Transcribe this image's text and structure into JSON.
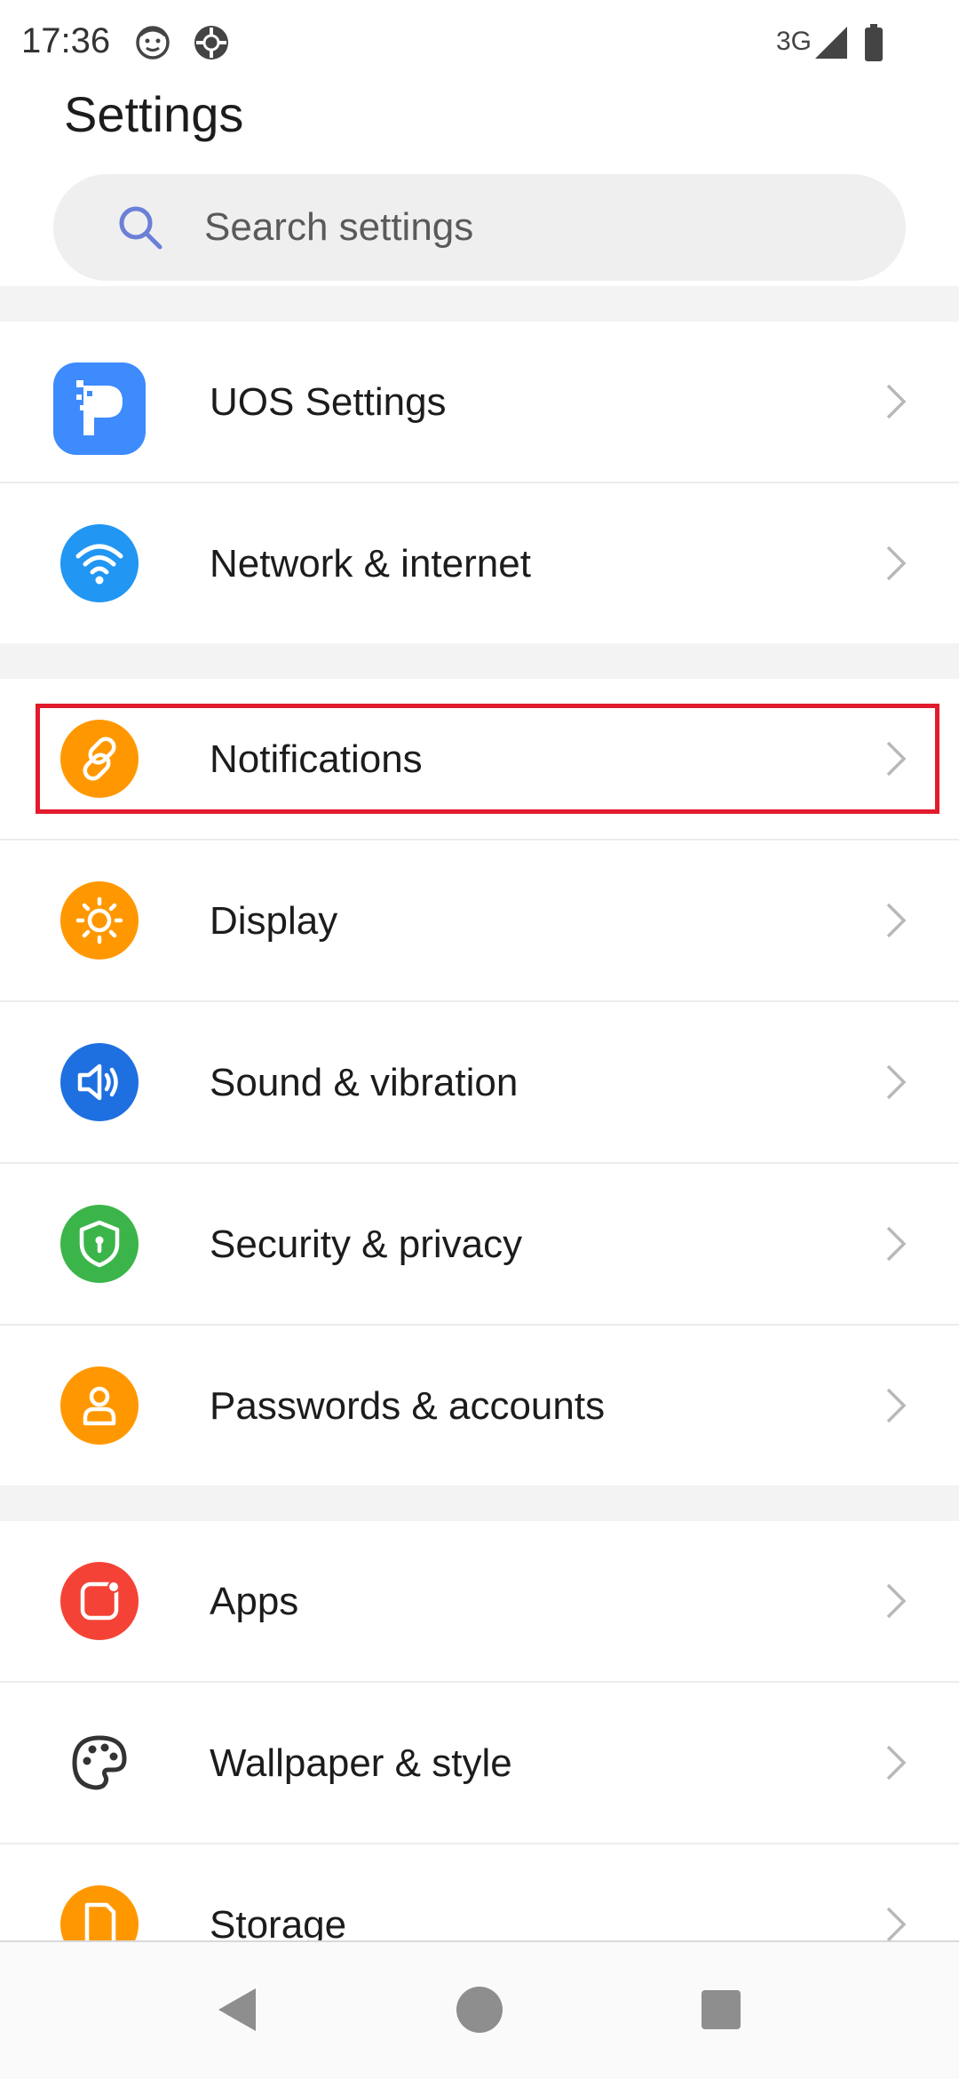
{
  "status_bar": {
    "time": "17:36",
    "network": "3G",
    "icons": [
      "face-icon",
      "ball-icon",
      "signal-icon",
      "battery-icon"
    ]
  },
  "header": {
    "title": "Settings"
  },
  "search": {
    "placeholder": "Search settings",
    "icon": "search-icon"
  },
  "items": [
    {
      "label": "UOS Settings",
      "icon": "uos-app-icon",
      "color": "#3d8bfd"
    },
    {
      "label": "Network & internet",
      "icon": "wifi-icon",
      "color": "#2196f3"
    },
    {
      "label": "Notifications",
      "icon": "link-icon",
      "color": "#ff9800"
    },
    {
      "label": "Display",
      "icon": "sun-icon",
      "color": "#ff9800"
    },
    {
      "label": "Sound & vibration",
      "icon": "speaker-icon",
      "color": "#1e6fe0"
    },
    {
      "label": "Security & privacy",
      "icon": "shield-icon",
      "color": "#3bb54a"
    },
    {
      "label": "Passwords & accounts",
      "icon": "person-icon",
      "color": "#ff9800"
    },
    {
      "label": "Apps",
      "icon": "apps-icon",
      "color": "#f44336"
    },
    {
      "label": "Wallpaper & style",
      "icon": "palette-icon",
      "color": "#333333"
    },
    {
      "label": "Storage",
      "icon": "storage-icon",
      "color": "#ff9800"
    }
  ],
  "highlight_color": "#e21b2c",
  "nav": {
    "icons": [
      "back-icon",
      "home-icon",
      "recents-icon"
    ]
  }
}
